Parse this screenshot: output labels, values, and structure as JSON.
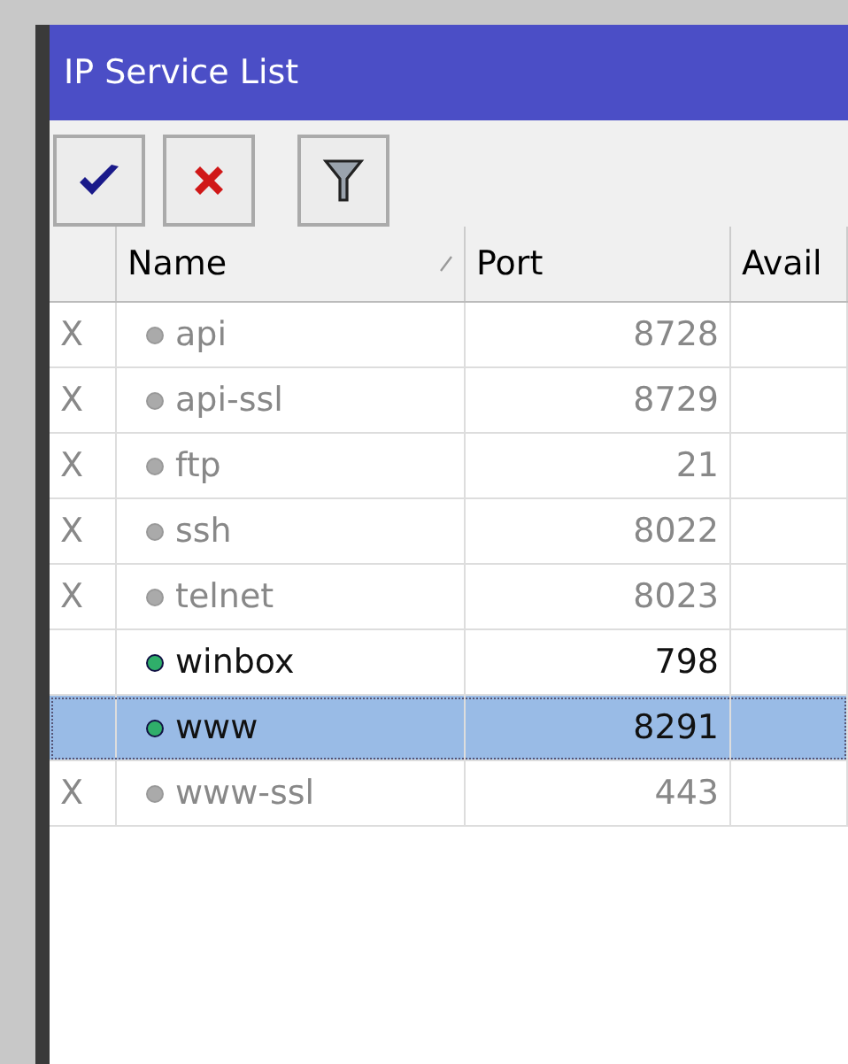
{
  "window": {
    "title": "IP Service List"
  },
  "toolbar": [
    {
      "kind": "enable"
    },
    {
      "kind": "disable"
    },
    {
      "kind": "filter"
    }
  ],
  "table": {
    "columns": [
      "Name",
      "Port",
      "Avail"
    ],
    "rows": [
      {
        "flag": "X",
        "name": "api",
        "port": "8728",
        "disabled": true,
        "selected": false
      },
      {
        "flag": "X",
        "name": "api-ssl",
        "port": "8729",
        "disabled": true,
        "selected": false
      },
      {
        "flag": "X",
        "name": "ftp",
        "port": "21",
        "disabled": true,
        "selected": false
      },
      {
        "flag": "X",
        "name": "ssh",
        "port": "8022",
        "disabled": true,
        "selected": false
      },
      {
        "flag": "X",
        "name": "telnet",
        "port": "8023",
        "disabled": true,
        "selected": false
      },
      {
        "name": "winbox",
        "port": "798",
        "disabled": false,
        "selected": false
      },
      {
        "name": "www",
        "port": "8291",
        "disabled": false,
        "selected": true
      },
      {
        "flag": "X",
        "name": "www-ssl",
        "port": "443",
        "disabled": true,
        "selected": false
      }
    ]
  }
}
